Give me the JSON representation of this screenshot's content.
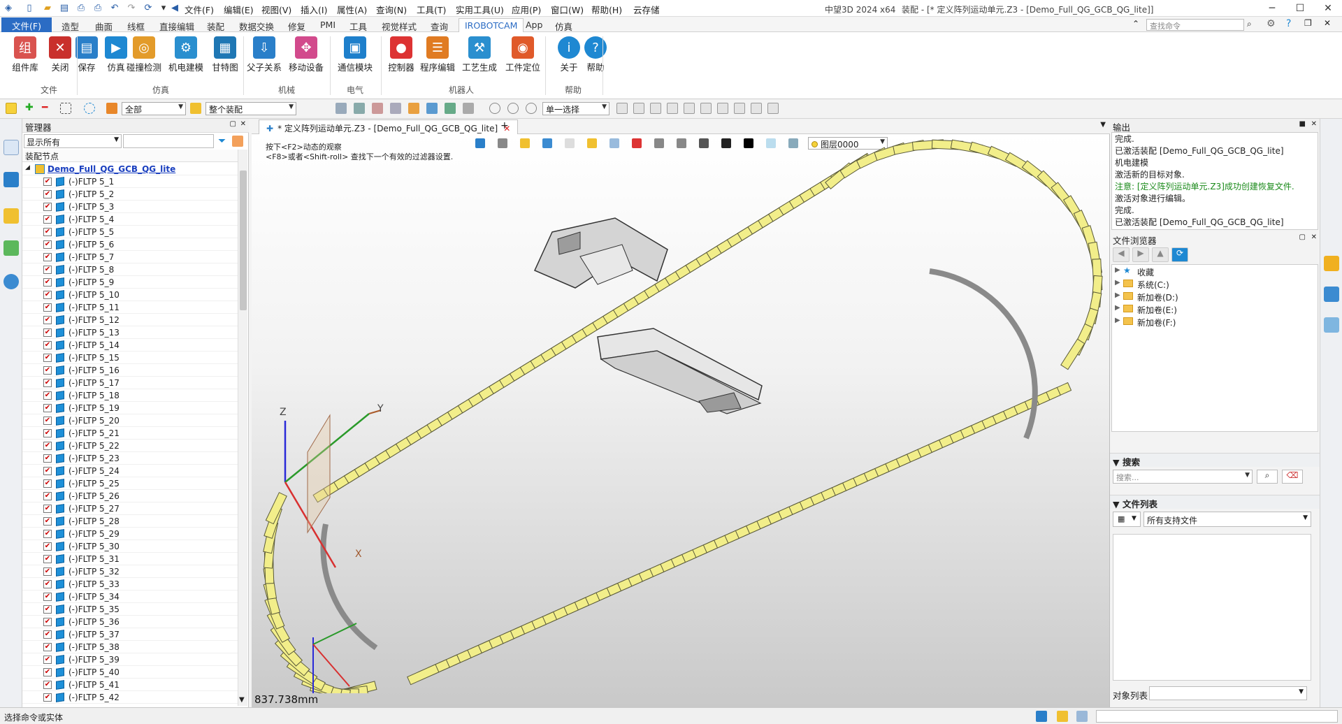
{
  "titlebar": {
    "menus": [
      "文件(F)",
      "编辑(E)",
      "视图(V)",
      "插入(I)",
      "属性(A)",
      "查询(N)",
      "工具(T)",
      "实用工具(U)",
      "应用(P)",
      "窗口(W)",
      "帮助(H)",
      "云存储"
    ],
    "app": "中望3D 2024 x64",
    "doc": "装配 - [* 定义阵列运动单元.Z3 - [Demo_Full_QG_GCB_QG_lite]]"
  },
  "tabs": [
    "文件(F)",
    "造型",
    "曲面",
    "线框",
    "直接编辑",
    "装配",
    "数据交换",
    "修复",
    "PMI",
    "工具",
    "视觉样式",
    "查询",
    "IROBOTCAM",
    "App",
    "仿真"
  ],
  "cmd_search": "查找命令",
  "ribbon": {
    "buttons": [
      {
        "label": "组件库",
        "color": "#d9534f",
        "icon": "组"
      },
      {
        "label": "关闭",
        "color": "#c9302c",
        "icon": "✕"
      },
      {
        "label": "保存",
        "color": "#2a7fc9",
        "icon": "▤"
      },
      {
        "label": "仿真",
        "color": "#1e88d2",
        "icon": "▶"
      },
      {
        "label": "碰撞检测",
        "color": "#e39b2a",
        "icon": "◎"
      },
      {
        "label": "机电建模",
        "color": "#2a8fcf",
        "icon": "⚙"
      },
      {
        "label": "甘特图",
        "color": "#1f77b4",
        "icon": "▦"
      },
      {
        "label": "父子关系",
        "color": "#2a7fc9",
        "icon": "⇩"
      },
      {
        "label": "移动设备",
        "color": "#d24a8c",
        "icon": "✥"
      },
      {
        "label": "通信模块",
        "color": "#1e7fcb",
        "icon": "▣"
      },
      {
        "label": "控制器",
        "color": "#d33",
        "icon": "●"
      },
      {
        "label": "程序编辑",
        "color": "#e07b22",
        "icon": "☰"
      },
      {
        "label": "工艺生成",
        "color": "#2a8fcf",
        "icon": "⚒"
      },
      {
        "label": "工件定位",
        "color": "#e05a2a",
        "icon": "◉"
      },
      {
        "label": "关于",
        "color": "#1e88d2",
        "icon": "i"
      },
      {
        "label": "帮助",
        "color": "#1e88d2",
        "icon": "?"
      }
    ],
    "groups": [
      "文件",
      "仿真",
      "机械",
      "电气",
      "机器人",
      "帮助"
    ]
  },
  "toolbar2": {
    "filter": "全部",
    "scope": "整个装配",
    "selmode": "单一选择"
  },
  "manager": {
    "title": "管理器",
    "filter": "显示所有",
    "column": "装配节点",
    "root": "Demo_Full_QG_GCB_QG_lite",
    "items": [
      "(-)FLTP 5_1",
      "(-)FLTP 5_2",
      "(-)FLTP 5_3",
      "(-)FLTP 5_4",
      "(-)FLTP 5_5",
      "(-)FLTP 5_6",
      "(-)FLTP 5_7",
      "(-)FLTP 5_8",
      "(-)FLTP 5_9",
      "(-)FLTP 5_10",
      "(-)FLTP 5_11",
      "(-)FLTP 5_12",
      "(-)FLTP 5_13",
      "(-)FLTP 5_14",
      "(-)FLTP 5_15",
      "(-)FLTP 5_16",
      "(-)FLTP 5_17",
      "(-)FLTP 5_18",
      "(-)FLTP 5_19",
      "(-)FLTP 5_20",
      "(-)FLTP 5_21",
      "(-)FLTP 5_22",
      "(-)FLTP 5_23",
      "(-)FLTP 5_24",
      "(-)FLTP 5_25",
      "(-)FLTP 5_26",
      "(-)FLTP 5_27",
      "(-)FLTP 5_28",
      "(-)FLTP 5_29",
      "(-)FLTP 5_30",
      "(-)FLTP 5_31",
      "(-)FLTP 5_32",
      "(-)FLTP 5_33",
      "(-)FLTP 5_34",
      "(-)FLTP 5_35",
      "(-)FLTP 5_36",
      "(-)FLTP 5_37",
      "(-)FLTP 5_38",
      "(-)FLTP 5_39",
      "(-)FLTP 5_40",
      "(-)FLTP 5_41",
      "(-)FLTP 5_42"
    ]
  },
  "viewport": {
    "tab": "* 定义阵列运动单元.Z3 - [Demo_Full_QG_GCB_QG_lite]",
    "hint1": "按下<F2>动态的观察",
    "hint2": "<F8>或者<Shift-roll> 查找下一个有效的过滤器设置.",
    "layer": "图层0000",
    "measure": "837.738mm",
    "axes": {
      "x": "X",
      "y": "Y",
      "z": "Z"
    }
  },
  "output": {
    "title": "输出",
    "lines": [
      "完成.",
      "已激活装配 [Demo_Full_QG_GCB_QG_lite]",
      "机电建模",
      "激活新的目标对象.",
      "注意: [定义阵列运动单元.Z3]成功创建恢复文件.",
      "激活对象进行编辑。",
      "完成.",
      "已激活装配 [Demo_Full_QG_GCB_QG_lite]"
    ],
    "note_color": "#1a8a1a"
  },
  "browser": {
    "title": "文件浏览器",
    "favorites": "收藏",
    "drives": [
      "系统(C:)",
      "新加卷(D:)",
      "新加卷(E:)",
      "新加卷(F:)"
    ],
    "search_title": "搜索",
    "search_placeholder": "搜索...",
    "filelist_title": "文件列表",
    "filter": "所有支持文件",
    "objlist": "对象列表"
  },
  "status": "选择命令或实体",
  "colors": {
    "accent": "#2b6cc4",
    "chain": "#f2ee8a",
    "chain_edge": "#5a5a3a"
  }
}
